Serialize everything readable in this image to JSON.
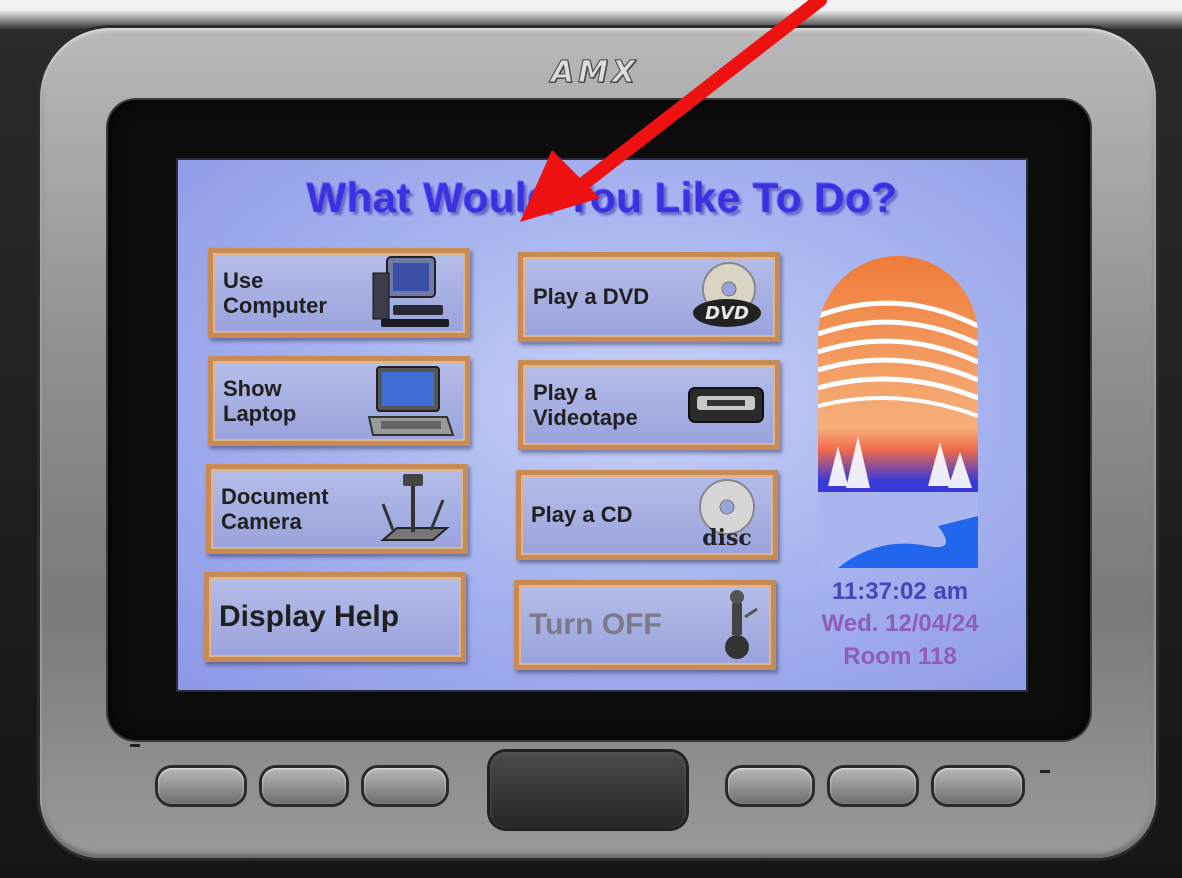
{
  "device": {
    "brand": "AMX"
  },
  "screen": {
    "title": "What Would You Like To Do?",
    "buttons": {
      "use_computer": "Use\nComputer",
      "show_laptop": "Show\nLaptop",
      "document_camera": "Document\nCamera",
      "display_help": "Display  Help",
      "play_dvd": "Play a DVD",
      "play_videotape": "Play  a\nVideotape",
      "play_cd": "Play a CD",
      "turn_off": "Turn OFF"
    },
    "status": {
      "time": "11:37:02 am",
      "date": "Wed. 12/04/24",
      "room": "Room 118"
    }
  },
  "icons": {
    "computer": "computer-icon",
    "laptop": "laptop-icon",
    "document_camera": "document-camera-icon",
    "dvd": "dvd-disc-icon",
    "videotape": "videotape-icon",
    "cd": "compact-disc-icon",
    "power": "power-off-icon",
    "logo": "arch-landscape-logo",
    "annotation_arrow": "red-arrow-icon"
  },
  "colors": {
    "title": "#3a32e0",
    "button_border": "#c98b54",
    "screen_bg": "#a9b6f0",
    "arrow": "#ee1111"
  }
}
